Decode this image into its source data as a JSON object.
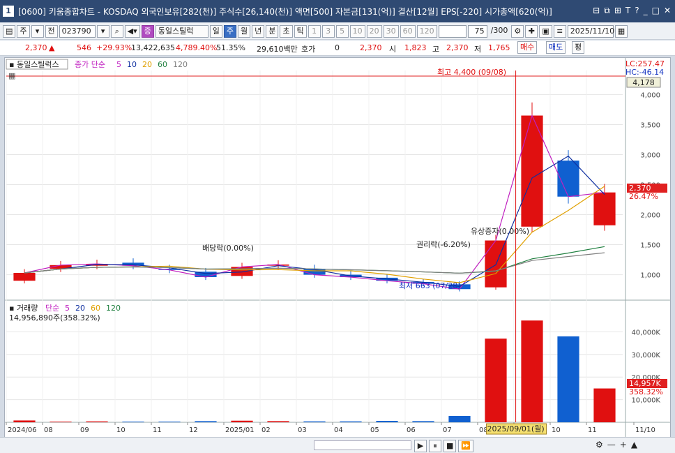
{
  "window": {
    "number_badge": "1",
    "title": "[0600] 키움종합차트 - KOSDAQ 외국인보유[282(천)] 주식수[26,140(천)] 액면[500] 자본금[131(억)] 결산[12월] EPS[-220] 시가총액[620(억)]",
    "controls": [
      "⊟",
      "⧉",
      "⊞",
      "T",
      "?",
      "_",
      "□",
      "✕"
    ]
  },
  "toolbar": {
    "period_select": "주",
    "all_btn": "전",
    "code": "023790",
    "stock_badge": "증",
    "stock_name": "동일스틸럭",
    "period_tabs": [
      "일",
      "주",
      "월",
      "년",
      "분",
      "초",
      "틱"
    ],
    "active_period": "주",
    "intervals": [
      "1",
      "3",
      "5",
      "10",
      "20",
      "30",
      "60",
      "120"
    ],
    "count": "75",
    "count_total": "/300",
    "date": "2025/11/10"
  },
  "quote": {
    "price": "2,370",
    "change": "546",
    "change_pct": "+29.93%",
    "volume": "13,422,635",
    "volume_pct": "4,789.40%",
    "turnover_pct": "51.35%",
    "amount": "29,610백만",
    "hoga_label": "호가",
    "hoga_value": "0",
    "hoga_price": "2,370",
    "open_label": "시",
    "open": "1,823",
    "high_label": "고",
    "high": "2,370",
    "low_label": "저",
    "low": "1,765",
    "buy_btn": "매수",
    "sell_btn": "매도",
    "eval_btn": "평"
  },
  "price_pane": {
    "legend_name": "동일스틸럭스",
    "ma_label": "종가 단순",
    "ma_periods": [
      "5",
      "10",
      "20",
      "60",
      "120"
    ],
    "ma_colors": [
      "#c020c0",
      "#1030a0",
      "#e0a000",
      "#208040",
      "#808080"
    ],
    "lc": "LC:257.47",
    "hc": "HC:-46.14",
    "top_value": "4,178",
    "last_price": "2,370",
    "last_pct": "26.47%",
    "high_note": "최고 4,400 (09/08)",
    "low_note": "최저 663 (07/28)",
    "annotations": [
      "배당락(0.00%)",
      "권리락(-6.20%)",
      "유상증자(0.00%)"
    ],
    "y_ticks": [
      "4,000",
      "3,500",
      "3,000",
      "2,500",
      "2,000",
      "1,500",
      "1,000"
    ]
  },
  "volume_pane": {
    "legend_name": "거래량",
    "ma_label": "단순",
    "ma_periods": [
      "5",
      "20",
      "60",
      "120"
    ],
    "current": "14,956,890주(358.32%)",
    "last_value": "14,957K",
    "last_pct": "358.32%",
    "y_ticks": [
      "40,000K",
      "30,000K",
      "20,000K",
      "10,000K"
    ]
  },
  "x_axis": {
    "labels": [
      "2024/06",
      "08",
      "09",
      "10",
      "11",
      "12",
      "2025/01",
      "02",
      "03",
      "04",
      "05",
      "06",
      "07",
      "08",
      "09",
      "10",
      "11",
      "11/10"
    ],
    "crosshair_date": "2025/09/01(월)"
  },
  "chart_data": {
    "type": "candlestick",
    "x": [
      "2024/06",
      "2024/08",
      "2024/09",
      "2024/10",
      "2024/11",
      "2024/12",
      "2025/01",
      "2025/02",
      "2025/03",
      "2025/04",
      "2025/05",
      "2025/06",
      "2025/07",
      "2025/08",
      "2025/09",
      "2025/10",
      "2025/11"
    ],
    "series": [
      {
        "open": 900,
        "close": 1030
      },
      {
        "open": 1100,
        "close": 1160
      },
      {
        "open": 1150,
        "close": 1180
      },
      {
        "open": 1200,
        "close": 1150
      },
      {
        "open": 1100,
        "close": 1080
      },
      {
        "open": 1050,
        "close": 960
      },
      {
        "open": 980,
        "close": 1130
      },
      {
        "open": 1150,
        "close": 1170
      },
      {
        "open": 1100,
        "close": 1000
      },
      {
        "open": 1000,
        "close": 960
      },
      {
        "open": 950,
        "close": 900
      },
      {
        "open": 880,
        "close": 850
      },
      {
        "open": 840,
        "close": 760
      },
      {
        "open": 790,
        "close": 1570
      },
      {
        "open": 1800,
        "close": 3650
      },
      {
        "open": 2900,
        "close": 2300
      },
      {
        "open": 1823,
        "close": 2370
      }
    ],
    "volume_k": [
      800,
      300,
      400,
      300,
      300,
      500,
      700,
      500,
      400,
      400,
      600,
      500,
      2800,
      37000,
      45000,
      38000,
      14957
    ],
    "high": 4400,
    "high_date": "09/08",
    "low": 663,
    "low_date": "07/28",
    "ylim": [
      600,
      4400
    ]
  }
}
